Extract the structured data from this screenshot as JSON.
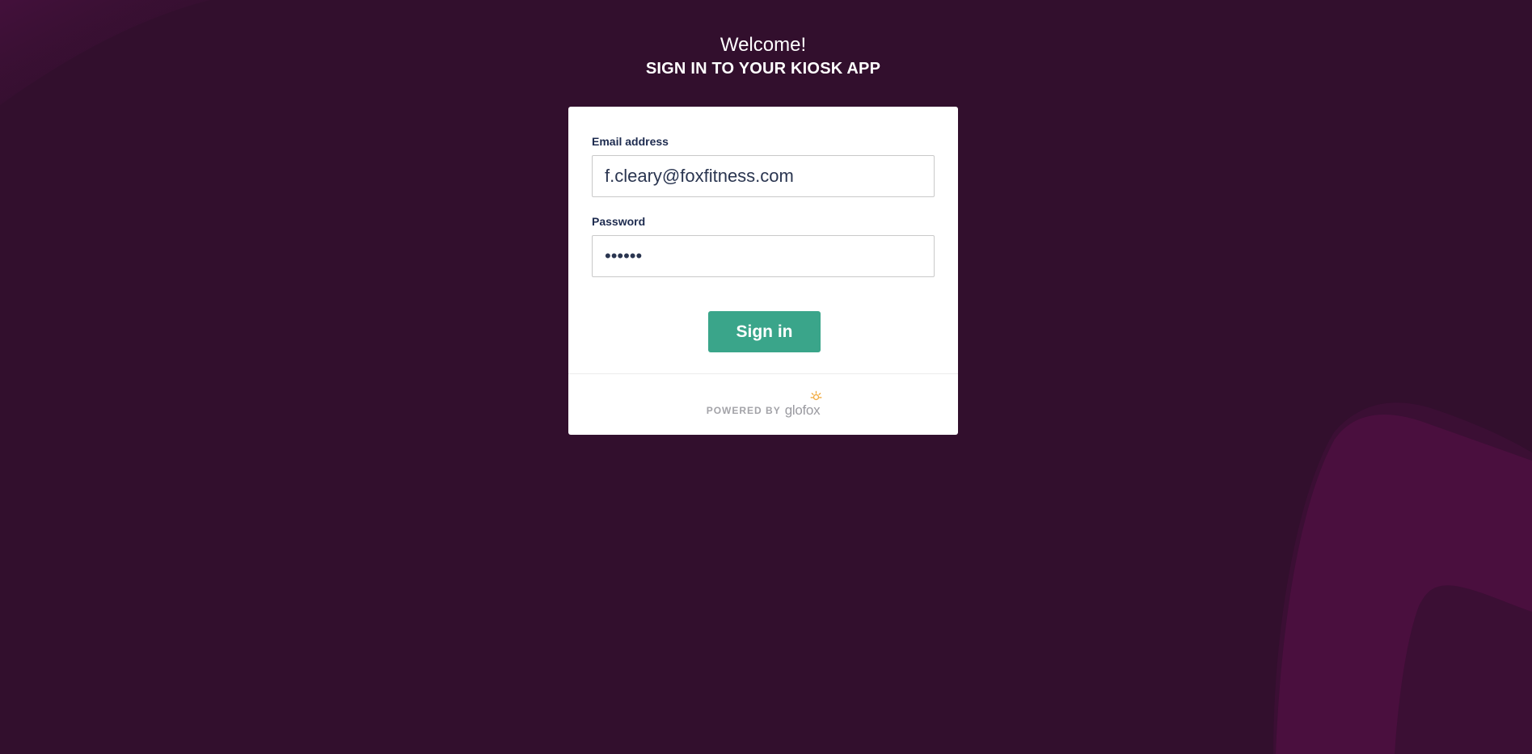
{
  "header": {
    "welcome": "Welcome!",
    "subtitle": "SIGN IN TO YOUR KIOSK APP"
  },
  "form": {
    "email_label": "Email address",
    "email_value": "f.cleary@foxfitness.com",
    "password_label": "Password",
    "password_value": "••••••",
    "submit_label": "Sign in"
  },
  "footer": {
    "powered_by": "POWERED BY",
    "brand": "glofox",
    "brand_icon": "glofox-logo-icon"
  },
  "colors": {
    "background": "#320f2d",
    "background_accent": "#4a0f3e",
    "button": "#3aa58a",
    "label_text": "#1d2b4f",
    "brand_icon": "#f2a93b"
  }
}
